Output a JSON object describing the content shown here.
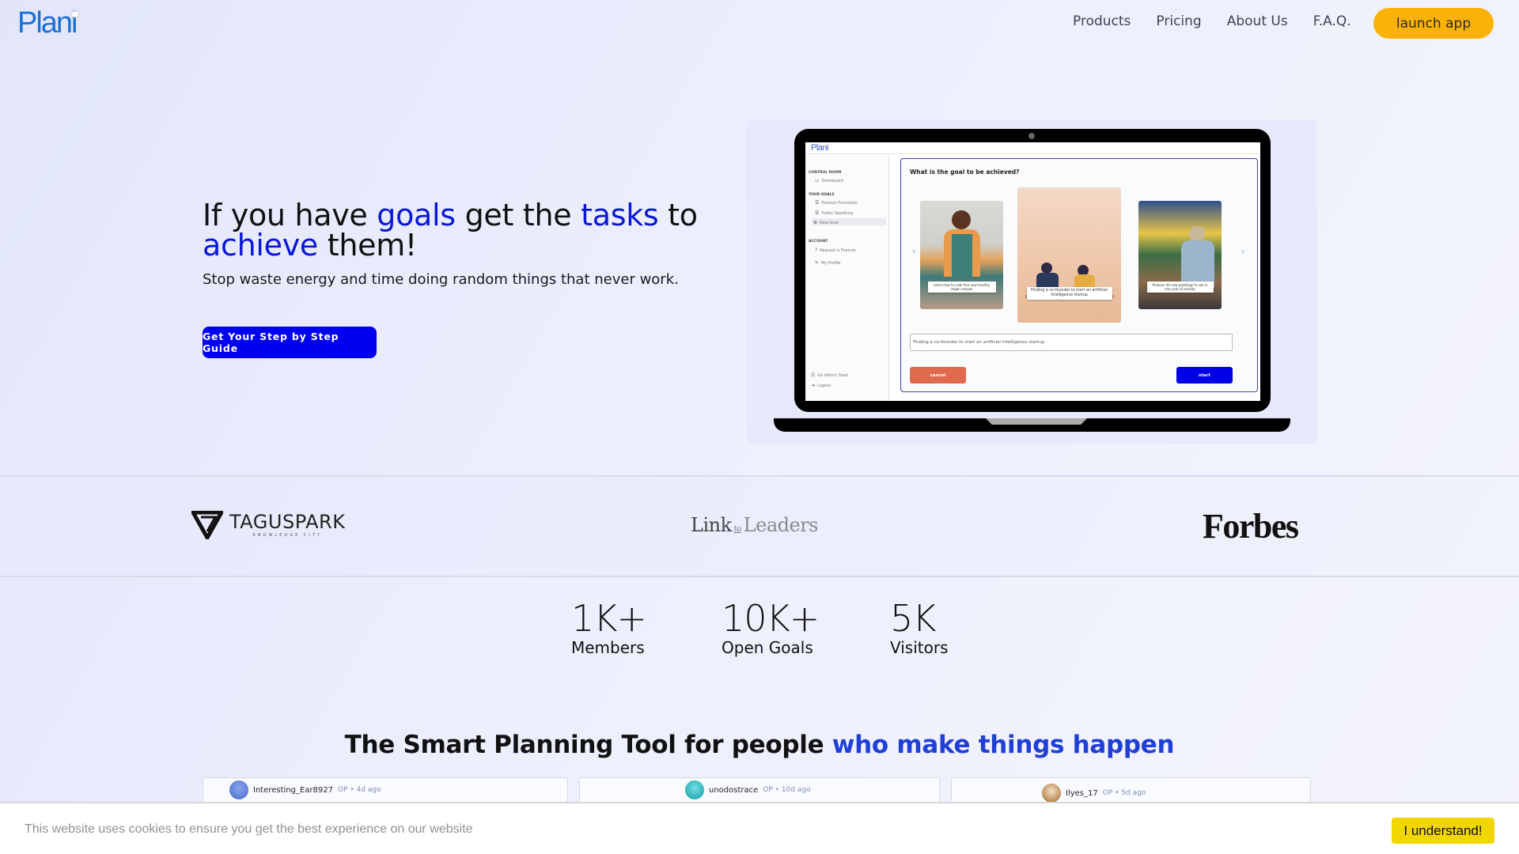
{
  "header": {
    "logo": "Plani",
    "nav": [
      "Products",
      "Pricing",
      "About Us",
      "F.A.Q."
    ],
    "launch_label": "launch app"
  },
  "hero": {
    "headline": {
      "p1": "If you have ",
      "goals": "goals",
      "p2": " get the ",
      "tasks": "tasks",
      "p3": " to",
      "achieve": "achieve",
      "p4": " them!"
    },
    "subtitle": "Stop waste energy and time doing random things that never work.",
    "cta_label": "Get Your Step by Step Guide",
    "colors": {
      "accent": "#0a17d8",
      "cta": "#0000f0",
      "launch": "#fbb208"
    }
  },
  "mockup": {
    "logo": "Plani",
    "sidebar": {
      "sections": [
        {
          "title": "CONTROL ROOM",
          "items": [
            {
              "icon": "monitor-icon",
              "label": "Dashboard"
            }
          ]
        },
        {
          "title": "YOUR GOALS",
          "items": [
            {
              "icon": "list-icon",
              "label": "Product Promotion"
            },
            {
              "icon": "list-icon",
              "label": "Public Speaking"
            },
            {
              "icon": "plus-circle-icon",
              "label": "New Goal",
              "active": true
            }
          ]
        },
        {
          "title": "ACCOUNT",
          "items": [
            {
              "icon": "help-circle-icon",
              "label": "Request a Feature"
            },
            {
              "icon": "edit-icon",
              "label": "My Profile"
            }
          ]
        }
      ],
      "footer": [
        {
          "icon": "sliders-icon",
          "label": "Go Admin Dash"
        },
        {
          "icon": "logout-icon",
          "label": "Logout"
        }
      ]
    },
    "question": "What is the goal to be achieved?",
    "cards": [
      {
        "caption": "Learn how to cook five new healthy vegan recipes"
      },
      {
        "caption": "Finding a co-founder to start an artificial intelligence startup"
      },
      {
        "caption": "Produce 10 new paintings to sell in one year of activity"
      }
    ],
    "input_value": "Finding a co-founder to start an artificial intelligence startup",
    "cancel_label": "cancel",
    "start_label": "start"
  },
  "partners": {
    "taguspark": {
      "name": "TAGUSPARK",
      "sub": "KNOWLEDGE CITY"
    },
    "link_to_leaders": {
      "link": "Link",
      "to": "to",
      "leaders": "Leaders"
    },
    "forbes": "Forbes"
  },
  "stats": [
    {
      "value": "1K+",
      "label": "Members"
    },
    {
      "value": "10K+",
      "label": "Open Goals"
    },
    {
      "value": "5K",
      "label": "Visitors"
    }
  ],
  "section": {
    "heading_main": "The Smart Planning Tool for people ",
    "heading_accent": "who make things happen"
  },
  "reviews": [
    {
      "user": "Interesting_Ear8927",
      "meta": "OP • 4d ago",
      "avatar_color": "#6f8fe0"
    },
    {
      "user": "unodostrace",
      "meta": "OP • 10d ago",
      "avatar_color": "#3fc0c8"
    },
    {
      "user": "Ilyes_17",
      "meta": "OP • 5d ago",
      "avatar_color": "#c9a070"
    }
  ],
  "cookie": {
    "text": "This website uses cookies to ensure you get the best experience on our website",
    "button_label": "I understand!"
  }
}
